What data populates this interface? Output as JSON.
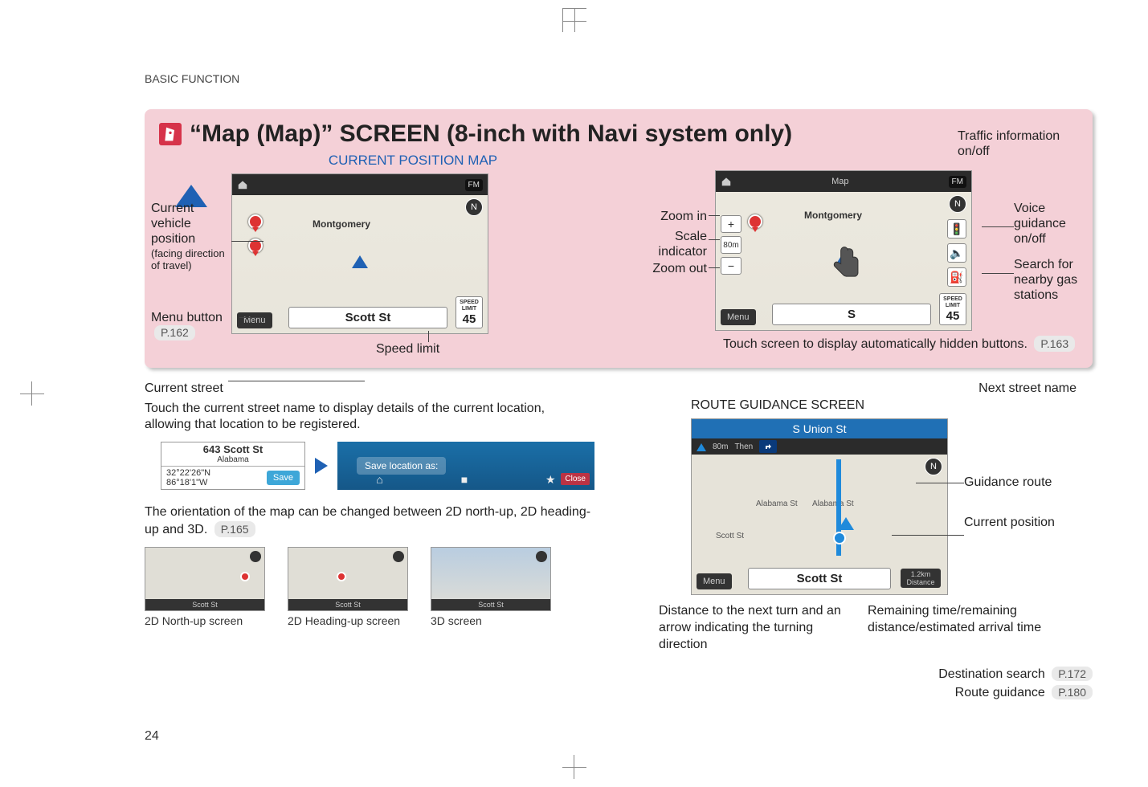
{
  "header": "BASIC FUNCTION",
  "pageNumber": "24",
  "section": {
    "title": "“Map (Map)” SCREEN (8-inch with Navi system only)"
  },
  "leftMap": {
    "heading": "CURRENT POSITION MAP",
    "street": "Scott St",
    "speedLimit": "45",
    "speedLimitLabel": "SPEED LIMIT",
    "fm": "FM",
    "city": "Montgomery",
    "menu": "Menu",
    "callouts": {
      "currentVehicle": "Current vehicle position",
      "currentVehicleSub": "(facing direction of travel)",
      "menuButton": "Menu button",
      "menuRef": "P.162",
      "speedLimit": "Speed limit",
      "currentStreet": "Current street",
      "currentStreetDetail": "Touch the current street name to display details of the current location, allowing that location to be registered."
    }
  },
  "rightMap": {
    "callouts": {
      "traffic": "Traffic information on/off",
      "voice": "Voice guidance on/off",
      "gas": "Search for nearby gas stations",
      "zoomIn": "Zoom in",
      "scale": "Scale indicator",
      "zoomOut": "Zoom out",
      "touchNote": "Touch screen to display  automatically hidden buttons.",
      "touchRef": "P.163"
    },
    "street": "S",
    "menu": "Menu",
    "speedLimit": "45",
    "city": "Montgomery",
    "fm": "FM"
  },
  "locationDetail": {
    "address": "643 Scott St",
    "state": "Alabama",
    "coordsN": "32°22'26\"N",
    "coordsW": "86°18'1\"W",
    "save": "Save",
    "saveLocationAs": "Save location as:",
    "close": "Close"
  },
  "orientation": {
    "text": "The orientation of the map can be changed between 2D north-up, 2D heading-up and 3D.",
    "ref": "P.165",
    "thumbs": {
      "northUp": "2D North-up screen",
      "headingUp": "2D Heading-up screen",
      "threeD": "3D screen",
      "band": "Scott St"
    }
  },
  "routeGuidance": {
    "heading": "ROUTE GUIDANCE SCREEN",
    "nextStreetLabel": "Next street name",
    "nextStreet": "S Union St",
    "street": "Scott St",
    "menu": "Menu",
    "callouts": {
      "guidanceRoute": "Guidance route",
      "currentPosition": "Current position",
      "distance": "Distance to the next turn and an arrow indicating the turning direction",
      "remaining": "Remaining time/remaining distance/estimated arrival time"
    },
    "destinationSearch": "Destination search",
    "destRef": "P.172",
    "routeGuidanceLabel": "Route guidance",
    "routeRef": "P.180"
  }
}
